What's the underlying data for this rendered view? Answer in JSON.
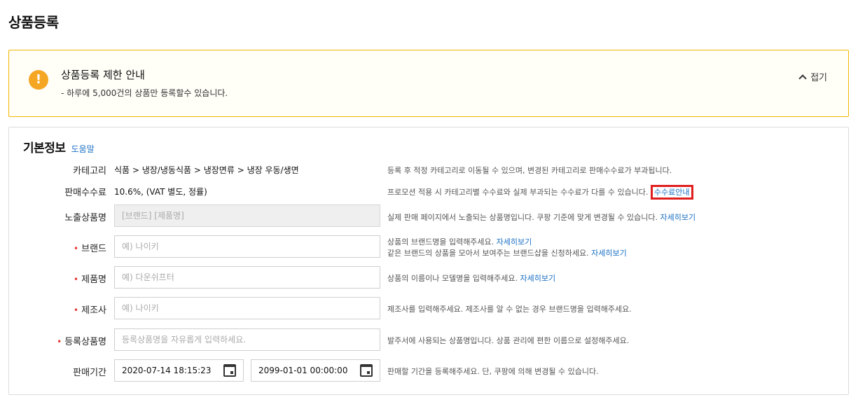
{
  "page": {
    "title": "상품등록"
  },
  "notice": {
    "title": "상품등록 제한 안내",
    "desc": "- 하루에 5,000건의 상품만 등록할수 있습니다.",
    "collapse_label": "접기"
  },
  "basic": {
    "heading": "기본정보",
    "help_label": "도움말",
    "category": {
      "label": "카테고리",
      "value": "식품 > 냉장/냉동식품 > 냉장면류 > 냉장 우동/생면",
      "hint": "등록 후 적정 카테고리로 이동될 수 있으며, 변경된 카테고리로 판매수수료가 부과됩니다."
    },
    "fee": {
      "label": "판매수수료",
      "value": "10.6%, (VAT 별도, 정률)",
      "hint": "프로모션 적용 시 카테고리별 수수료와 실제 부과되는 수수료가 다를 수 있습니다.",
      "link": "수수료안내"
    },
    "display_name": {
      "label": "노출상품명",
      "placeholder": "[브랜드] [제품명]",
      "hint": "실제 판매 페이지에서 노출되는 상품명입니다. 쿠팡 기준에 맞게 변경될 수 있습니다.",
      "link": "자세히보기"
    },
    "brand": {
      "label": "브랜드",
      "placeholder": "예) 나이키",
      "hint1": "상품의 브랜드명을 입력해주세요.",
      "link1": "자세히보기",
      "hint2": "같은 브랜드의 상품을 모아서 보여주는 브랜드샵을 신청하세요.",
      "link2": "자세히보기"
    },
    "product_name": {
      "label": "제품명",
      "placeholder": "예) 다운쉬프터",
      "hint": "상품의 이름이나 모델명을 입력해주세요.",
      "link": "자세히보기"
    },
    "manufacturer": {
      "label": "제조사",
      "placeholder": "예) 나이키",
      "hint": "제조사를 입력해주세요. 제조사를 알 수 없는 경우 브랜드명을 입력해주세요."
    },
    "registered_name": {
      "label": "등록상품명",
      "placeholder": "등록상품명을 자유롭게 입력하세요.",
      "hint": "발주서에 사용되는 상품명입니다. 상품 관리에 편한 이름으로 설정해주세요."
    },
    "period": {
      "label": "판매기간",
      "start": "2020-07-14 18:15:23",
      "end": "2099-01-01 00:00:00",
      "hint": "판매할 기간을 등록해주세요. 단, 쿠팡에 의해 변경될 수 있습니다."
    }
  },
  "colors": {
    "accent_link": "#1a6fc4",
    "warning": "#f5a623",
    "required": "#e53935",
    "highlight_box": "#e01e1e"
  }
}
